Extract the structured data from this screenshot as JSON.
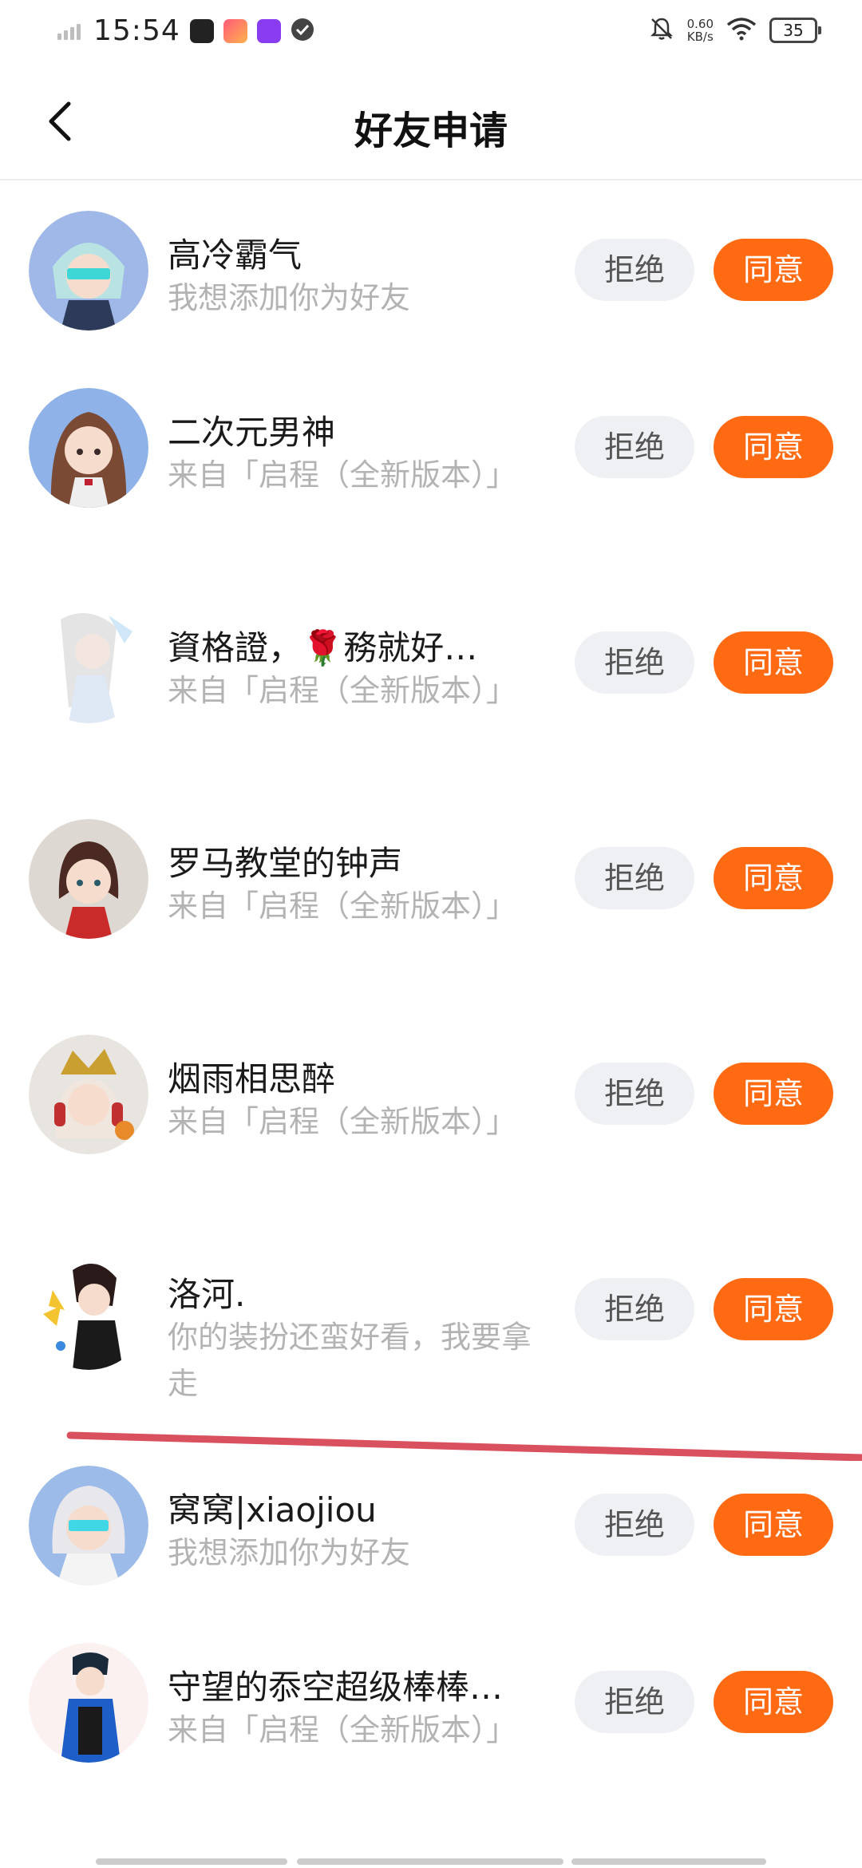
{
  "status_bar": {
    "time": "15:54",
    "net_speed": "0.60",
    "net_unit": "KB/s",
    "battery": "35",
    "icons": [
      "signal-icon",
      "app-icon-1",
      "app-icon-2",
      "app-icon-3",
      "check-circle-icon",
      "mute-bell-icon",
      "wifi-icon",
      "battery-icon"
    ]
  },
  "header": {
    "title": "好友申请",
    "back_icon": "chevron-left-icon"
  },
  "requests": [
    {
      "name": "高冷霸气",
      "message": "我想添加你为好友",
      "reject": "拒绝",
      "accept": "同意"
    },
    {
      "name": "二次元男神",
      "message": "来自「启程（全新版本）」",
      "reject": "拒绝",
      "accept": "同意"
    },
    {
      "name": "資格證，🌹務就好…",
      "message": "来自「启程（全新版本）」",
      "reject": "拒绝",
      "accept": "同意"
    },
    {
      "name": "罗马教堂的钟声",
      "message": "来自「启程（全新版本）」",
      "reject": "拒绝",
      "accept": "同意"
    },
    {
      "name": "烟雨相思醉",
      "message": "来自「启程（全新版本）」",
      "reject": "拒绝",
      "accept": "同意"
    },
    {
      "name": "洛河.",
      "message": "你的装扮还蛮好看，我要拿走",
      "reject": "拒绝",
      "accept": "同意"
    },
    {
      "name": "窝窝|xiaojiou",
      "message": "我想添加你为好友",
      "reject": "拒绝",
      "accept": "同意"
    },
    {
      "name": "守望的忝空超级棒棒…",
      "message": "来自「启程（全新版本）」",
      "reject": "拒绝",
      "accept": "同意"
    }
  ],
  "colors": {
    "accent": "#ff6a13",
    "reject_bg": "#eef0f4",
    "annotation_line": "#d9505e"
  }
}
